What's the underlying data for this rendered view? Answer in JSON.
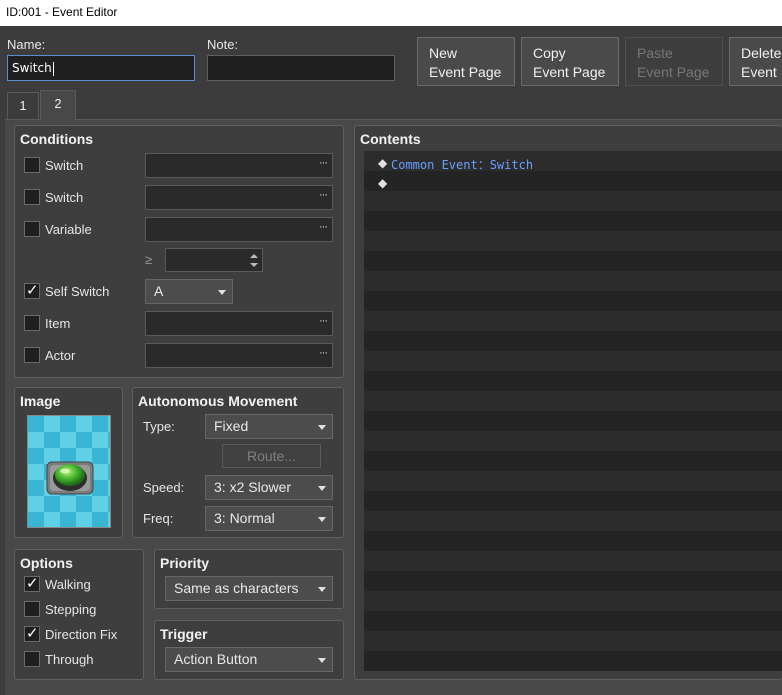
{
  "window": {
    "title": "ID:001 - Event Editor"
  },
  "fields": {
    "name_label": "Name:",
    "name_value": "Switch",
    "note_label": "Note:",
    "note_value": ""
  },
  "toolbar": {
    "new_line1": "New",
    "new_line2": "Event Page",
    "copy_line1": "Copy",
    "copy_line2": "Event Page",
    "paste_line1": "Paste",
    "paste_line2": "Event Page",
    "delete_line1": "Delete",
    "delete_line2": "Event"
  },
  "tabs": [
    {
      "label": "1"
    },
    {
      "label": "2"
    }
  ],
  "conditions": {
    "title": "Conditions",
    "switch1": {
      "label": "Switch",
      "checked": false,
      "value": ""
    },
    "switch2": {
      "label": "Switch",
      "checked": false,
      "value": ""
    },
    "variable": {
      "label": "Variable",
      "checked": false,
      "value": "",
      "compare": "≥",
      "number": ""
    },
    "self_switch": {
      "label": "Self Switch",
      "checked": true,
      "value": "A"
    },
    "item": {
      "label": "Item",
      "checked": false,
      "value": ""
    },
    "actor": {
      "label": "Actor",
      "checked": false,
      "value": ""
    },
    "dots": "···"
  },
  "image": {
    "title": "Image"
  },
  "movement": {
    "title": "Autonomous Movement",
    "type_label": "Type:",
    "type_value": "Fixed",
    "route_label": "Route...",
    "speed_label": "Speed:",
    "speed_value": "3: x2 Slower",
    "freq_label": "Freq:",
    "freq_value": "3: Normal"
  },
  "options": {
    "title": "Options",
    "walking": {
      "label": "Walking",
      "checked": true
    },
    "stepping": {
      "label": "Stepping",
      "checked": false
    },
    "direction_fix": {
      "label": "Direction Fix",
      "checked": true
    },
    "through": {
      "label": "Through",
      "checked": false
    }
  },
  "priority": {
    "title": "Priority",
    "value": "Same as characters"
  },
  "trigger": {
    "title": "Trigger",
    "value": "Action Button"
  },
  "contents": {
    "title": "Contents",
    "commands": [
      {
        "marker": "◆",
        "text": "Common Event：Switch"
      },
      {
        "marker": "◆",
        "text": ""
      }
    ]
  },
  "colors": {
    "command_text": "#6a9fff",
    "field_focus_border": "#5a8ed0"
  },
  "icons": {
    "check": "checkmark-icon",
    "dropdown": "chevron-down-icon"
  }
}
